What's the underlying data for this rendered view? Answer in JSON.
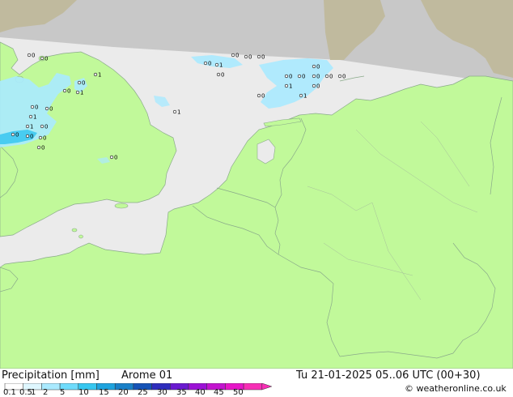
{
  "footer": {
    "title_left": "Precipitation [mm]",
    "model": "Arome 01",
    "datetime": "Tu 21-01-2025 05..06 UTC (00+30)",
    "copyright": "© weatheronline.co.uk"
  },
  "legend": {
    "ticks": [
      "0.1",
      "0.5",
      "1",
      "2",
      "5",
      "10",
      "15",
      "20",
      "25",
      "30",
      "35",
      "40",
      "45",
      "50"
    ],
    "colors": [
      "#ffffff",
      "#dff7ff",
      "#aaeaff",
      "#6fdcfc",
      "#36c7f0",
      "#1ea3de",
      "#1980c8",
      "#1553b7",
      "#2e2dbd",
      "#6a1ad0",
      "#9c12d6",
      "#c314cf",
      "#e616c8",
      "#f72fb6"
    ]
  },
  "map": {
    "colors": {
      "sea": "#ebebeb",
      "land": "#c1f99a",
      "outside_domain": "#c8c8c8",
      "outside_land": "#c0ba9e",
      "border": "#8aaa8a",
      "precip_light": "#aaeaff",
      "precip_medium": "#36c7f0"
    },
    "point_labels": [
      "0",
      "0",
      "1",
      "0",
      "1",
      "0",
      "0",
      "0",
      "1",
      "0",
      "1",
      "0",
      "0",
      "0",
      "0",
      "0",
      "1",
      "0",
      "1",
      "0",
      "0",
      "0",
      "0",
      "0",
      "0",
      "0",
      "0",
      "0",
      "0",
      "1",
      "0",
      "1",
      "0"
    ]
  }
}
